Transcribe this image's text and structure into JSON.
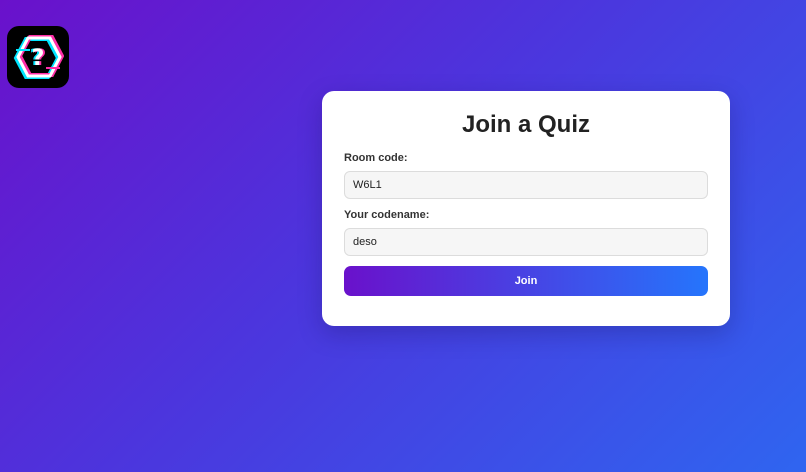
{
  "app": {
    "logo_icon": "glitch-hexagon-question-icon"
  },
  "card": {
    "title": "Join a Quiz",
    "room_code": {
      "label": "Room code:",
      "value": "W6L1"
    },
    "codename": {
      "label": "Your codename:",
      "value": "deso"
    },
    "join_label": "Join"
  },
  "colors": {
    "background_start": "#6a11cb",
    "background_end": "#2f65f0",
    "button_start": "#6a11cb",
    "button_end": "#2575fc",
    "card": "#ffffff"
  }
}
